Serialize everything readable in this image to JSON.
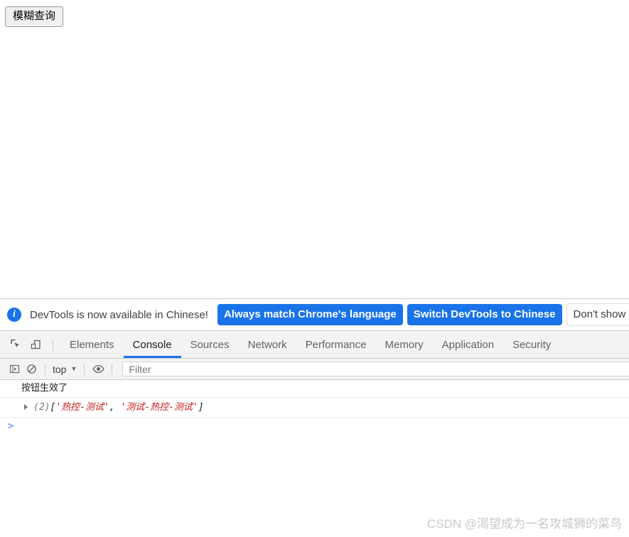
{
  "page": {
    "button_label": "模糊查询"
  },
  "devtools": {
    "infobar": {
      "icon": "info-icon",
      "message": "DevTools is now available in Chinese!",
      "primary_action_1": "Always match Chrome's language",
      "primary_action_2": "Switch DevTools to Chinese",
      "secondary_action": "Don't show again"
    },
    "tabbar": {
      "inspect_icon": "inspect-element-icon",
      "device_icon": "device-toolbar-icon",
      "tabs": [
        {
          "label": "Elements",
          "active": false
        },
        {
          "label": "Console",
          "active": true
        },
        {
          "label": "Sources",
          "active": false
        },
        {
          "label": "Network",
          "active": false
        },
        {
          "label": "Performance",
          "active": false
        },
        {
          "label": "Memory",
          "active": false
        },
        {
          "label": "Application",
          "active": false
        },
        {
          "label": "Security",
          "active": false
        }
      ]
    },
    "console_toolbar": {
      "sidebar_icon": "console-sidebar-icon",
      "clear_icon": "clear-console-icon",
      "context_value": "top",
      "caret": "▼",
      "eye_icon": "live-expression-eye-icon",
      "filter_placeholder": "Filter",
      "filter_value": ""
    },
    "console_messages": [
      {
        "type": "log",
        "text": "按钮生效了"
      },
      {
        "type": "object",
        "length_label": "(2)",
        "open_bracket": "[",
        "items": [
          "'热控-测试'",
          "'测试-热控-测试'"
        ],
        "separator": ", ",
        "close_bracket": "]"
      }
    ],
    "prompt": ">"
  },
  "watermark": {
    "text": "CSDN @渴望成为一名攻城狮的菜鸟"
  },
  "colors": {
    "accent_blue": "#1a73e8",
    "string_red": "#c41a16",
    "prompt_blue": "#6e9cf0",
    "toolbar_bg": "#f3f3f3",
    "watermark_gray": "#c9c9c9"
  }
}
